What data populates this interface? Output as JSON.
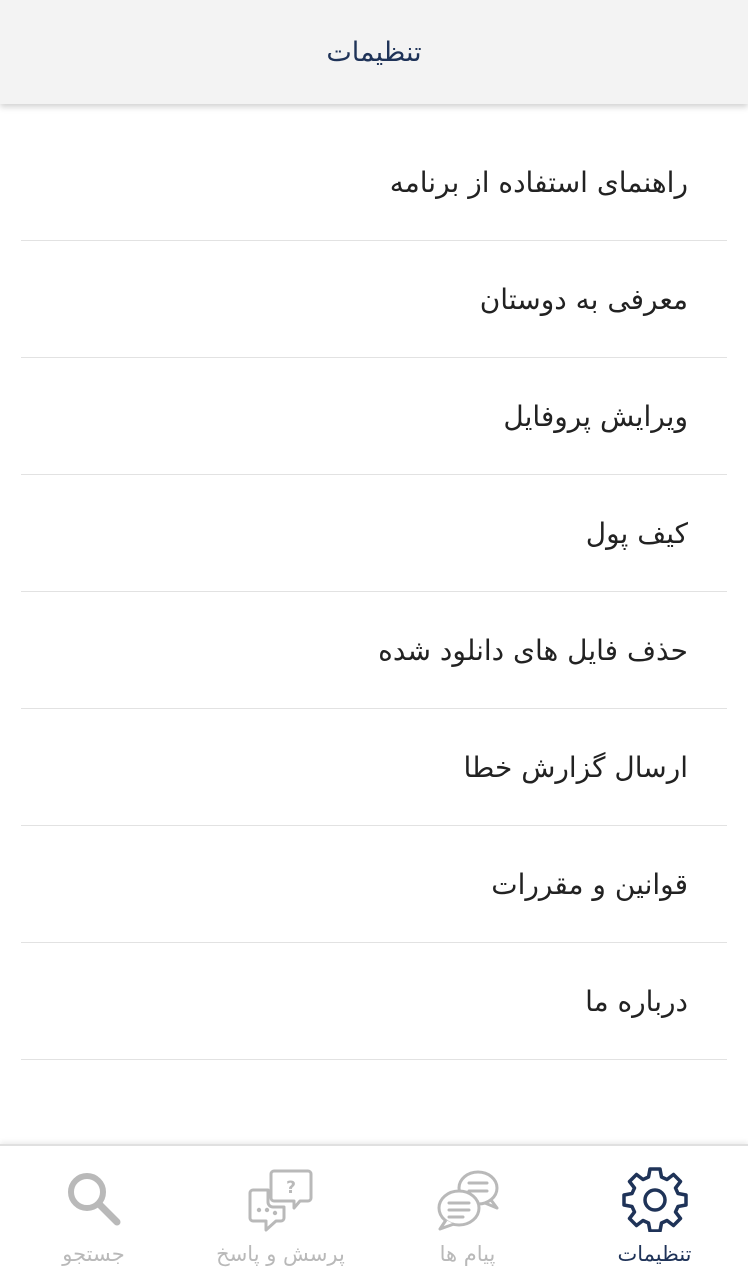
{
  "header": {
    "title": "تنظیمات"
  },
  "settings": {
    "items": [
      {
        "label": "راهنمای استفاده از برنامه"
      },
      {
        "label": "معرفی به دوستان"
      },
      {
        "label": "ویرایش پروفایل"
      },
      {
        "label": "کیف پول"
      },
      {
        "label": "حذف فایل های دانلود شده"
      },
      {
        "label": "ارسال گزارش خطا"
      },
      {
        "label": "قوانین و مقررات"
      },
      {
        "label": "درباره ما"
      }
    ]
  },
  "bottom_nav": {
    "items": [
      {
        "label": "جستجو",
        "icon": "search-icon",
        "active": false
      },
      {
        "label": "پرسش و پاسخ",
        "icon": "question-chat-icon",
        "active": false
      },
      {
        "label": "پیام ها",
        "icon": "messages-icon",
        "active": false
      },
      {
        "label": "تنظیمات",
        "icon": "gear-icon",
        "active": true
      }
    ]
  },
  "colors": {
    "accent": "#1f3358",
    "inactive": "#b9b9b9",
    "header_bg": "#f3f3f3",
    "divider": "#e2e2e2"
  }
}
